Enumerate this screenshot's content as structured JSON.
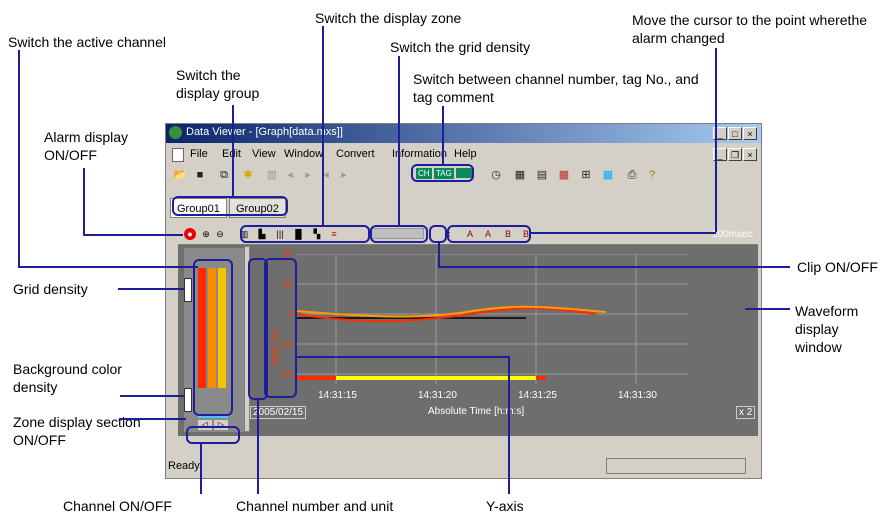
{
  "annotations": {
    "active_channel": "Switch the active channel",
    "display_zone": "Switch the display zone",
    "move_cursor": "Move the cursor to the point wherethe alarm changed",
    "grid_density_switch": "Switch the grid density",
    "display_group": "Switch the display group",
    "channel_tag": "Switch between channel number, tag No., and tag comment",
    "alarm_display": "Alarm display ON/OFF",
    "grid_density": "Grid density",
    "clip": "Clip ON/OFF",
    "waveform_window": "Waveform display window",
    "bg_color_density": "Background color density",
    "zone_display": "Zone display section ON/OFF",
    "channel_onoff": "Channel ON/OFF",
    "channel_number_unit": "Channel number and unit",
    "y_axis": "Y-axis"
  },
  "window": {
    "title": "Data Viewer - [Graph[data.mxs]]",
    "menu": [
      "File",
      "Edit",
      "View",
      "Window",
      "Convert",
      "Information",
      "Help"
    ],
    "tabs": [
      "Group01",
      "Group02"
    ],
    "toolbar_labels": {
      "ch": "CH",
      "tag": "TAG"
    },
    "cursor_buttons": [
      "A",
      "A",
      "B",
      "B"
    ],
    "time_per_div": "100msec",
    "status": "Ready",
    "graph": {
      "y_ticks": [
        "20",
        "10",
        "0",
        "-10",
        "-20"
      ],
      "x_ticks": [
        "14:31:15",
        "14:31:20",
        "14:31:25",
        "14:31:30"
      ],
      "date": "2005/02/15",
      "x_axis_label": "Absolute Time [h:m:s]",
      "zoom": "x 2",
      "channel_unit": "0001 [V]"
    }
  },
  "colors": {
    "highlight": "#1e1e9a",
    "trace_red": "#ff2a00",
    "trace_orange": "#ff9a00",
    "trace_yellow": "#ffff00",
    "bar_red": "#ff2a00",
    "bar_orange": "#ff8c00",
    "bar_yellow": "#f5c400"
  }
}
